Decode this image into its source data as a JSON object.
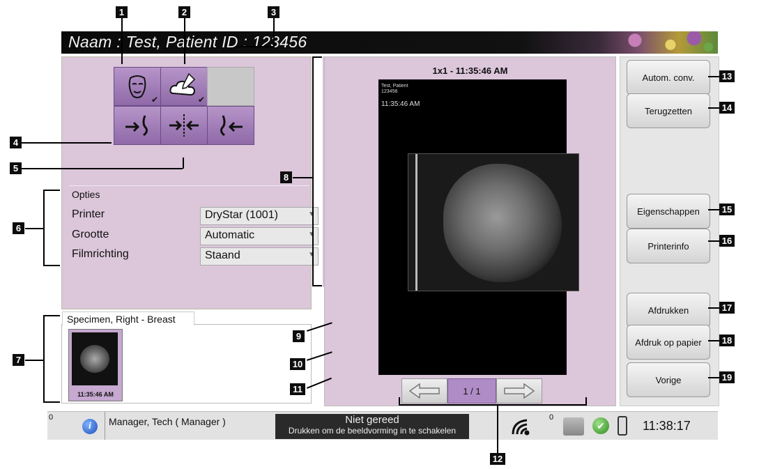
{
  "header": {
    "patient_line": "Naam : Test, Patient    ID : 123456"
  },
  "callouts": [
    "1",
    "2",
    "3",
    "4",
    "5",
    "6",
    "7",
    "8",
    "9",
    "10",
    "11",
    "12",
    "13",
    "14",
    "15",
    "16",
    "17",
    "18",
    "19"
  ],
  "options": {
    "heading": "Opties",
    "rows": [
      {
        "label": "Printer",
        "value": "DryStar (1001)"
      },
      {
        "label": "Grootte",
        "value": "Automatic"
      },
      {
        "label": "Filmrichting",
        "value": "Staand"
      }
    ]
  },
  "thumbnails": {
    "tab_label": "Specimen, Right - Breast",
    "items": [
      {
        "time": "11:35:46 AM"
      }
    ]
  },
  "viewer": {
    "title": "1x1 - 11:35:46 AM",
    "overlay_name": "Test, Patient",
    "overlay_id": "123456",
    "overlay_time": "11:35:46 AM",
    "page_indicator": "1 / 1"
  },
  "right_buttons": {
    "auto_conv": "Autom. conv.",
    "reset": "Terugzetten",
    "properties": "Eigenschappen",
    "printer_info": "Printerinfo",
    "print": "Afdrukken",
    "print_paper": "Afdruk op papier",
    "previous": "Vorige"
  },
  "status": {
    "alert_count": "0",
    "user": "Manager, Tech ( Manager )",
    "state_title": "Niet gereed",
    "state_sub": "Drukken om de beeldvorming in te schakelen",
    "queue_count": "0",
    "clock": "11:38:17"
  },
  "icons": {
    "face": "face-icon",
    "cloud": "cloud-edit-icon",
    "breast_left": "breast-left-icon",
    "breast_both": "breast-both-icon",
    "breast_right": "breast-right-icon",
    "add_image": "add-image-icon",
    "remove_image": "remove-image-icon",
    "remove_breast": "remove-breast-icon",
    "prev_arrow": "arrow-left-icon",
    "next_arrow": "arrow-right-icon"
  }
}
